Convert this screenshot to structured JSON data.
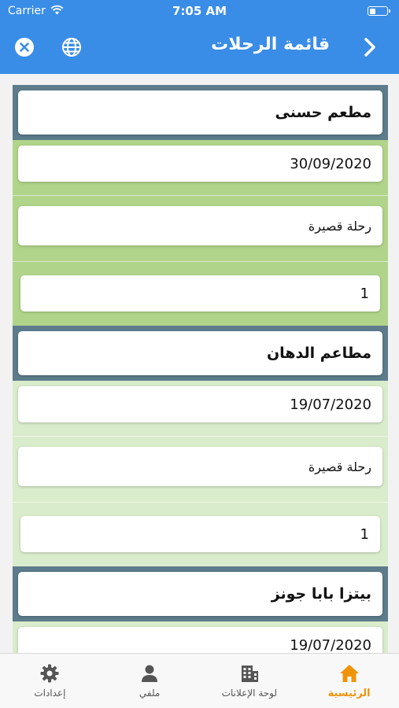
{
  "status_bar": {
    "carrier": "Carrier",
    "time": "7:05 AM"
  },
  "nav": {
    "title": "قائمة الرحلات",
    "icons": [
      "close-circle-icon",
      "globe-icon",
      "chevron-right-icon"
    ]
  },
  "trips": [
    {
      "name": "مطعم حسنى",
      "date": "30/09/2020",
      "type": "رحلة قصيرة",
      "count": "1"
    },
    {
      "name": "مطاعم الدهان",
      "date": "19/07/2020",
      "type": "رحلة قصيرة",
      "count": "1"
    },
    {
      "name": "بيتزا بابا جونز",
      "date": "19/07/2020"
    }
  ],
  "tab_bar": {
    "items": [
      {
        "label": "إعدادات",
        "icon": "gear-icon"
      },
      {
        "label": "ملفي",
        "icon": "person-icon"
      },
      {
        "label": "لوحة الإعلانات",
        "icon": "building-icon"
      },
      {
        "label": "الرئيسية",
        "icon": "home-icon"
      }
    ],
    "active_color": "#f0930a"
  },
  "colors": {
    "primary": "#3a8de6",
    "card_header": "#5d7c8c",
    "card_green": "#b0d48a",
    "card_light_green": "#d9eccc"
  }
}
